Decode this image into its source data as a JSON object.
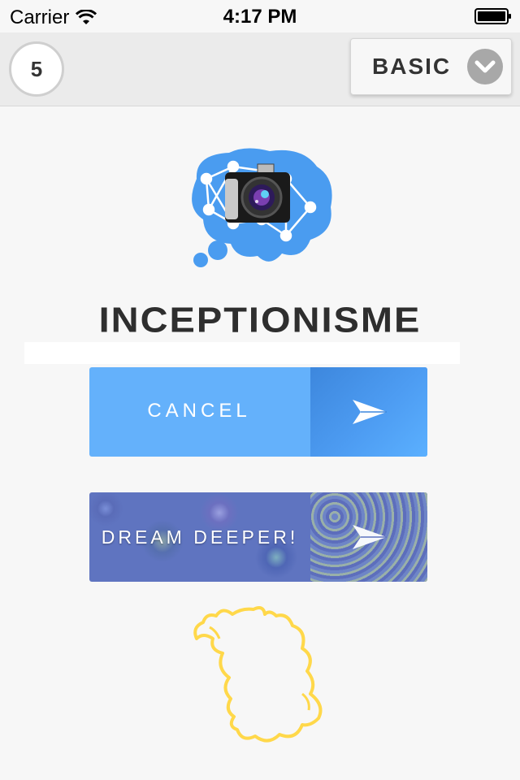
{
  "status_bar": {
    "carrier": "Carrier",
    "time": "4:17 PM"
  },
  "toolbar": {
    "count": "5",
    "mode_label": "BASIC"
  },
  "app": {
    "title": "INCEPTIONISME"
  },
  "buttons": {
    "cancel_label": "CANCEL",
    "dream_label": "DREAM DEEPER!"
  },
  "colors": {
    "accent_blue": "#64b1fb",
    "logo_blue": "#4a9cf0",
    "doodle_yellow": "#ffd84a"
  },
  "icons": {
    "wifi": "wifi-icon",
    "battery": "battery-icon",
    "chevron": "chevron-down-icon",
    "send": "send-icon",
    "logo": "brain-camera-logo"
  }
}
